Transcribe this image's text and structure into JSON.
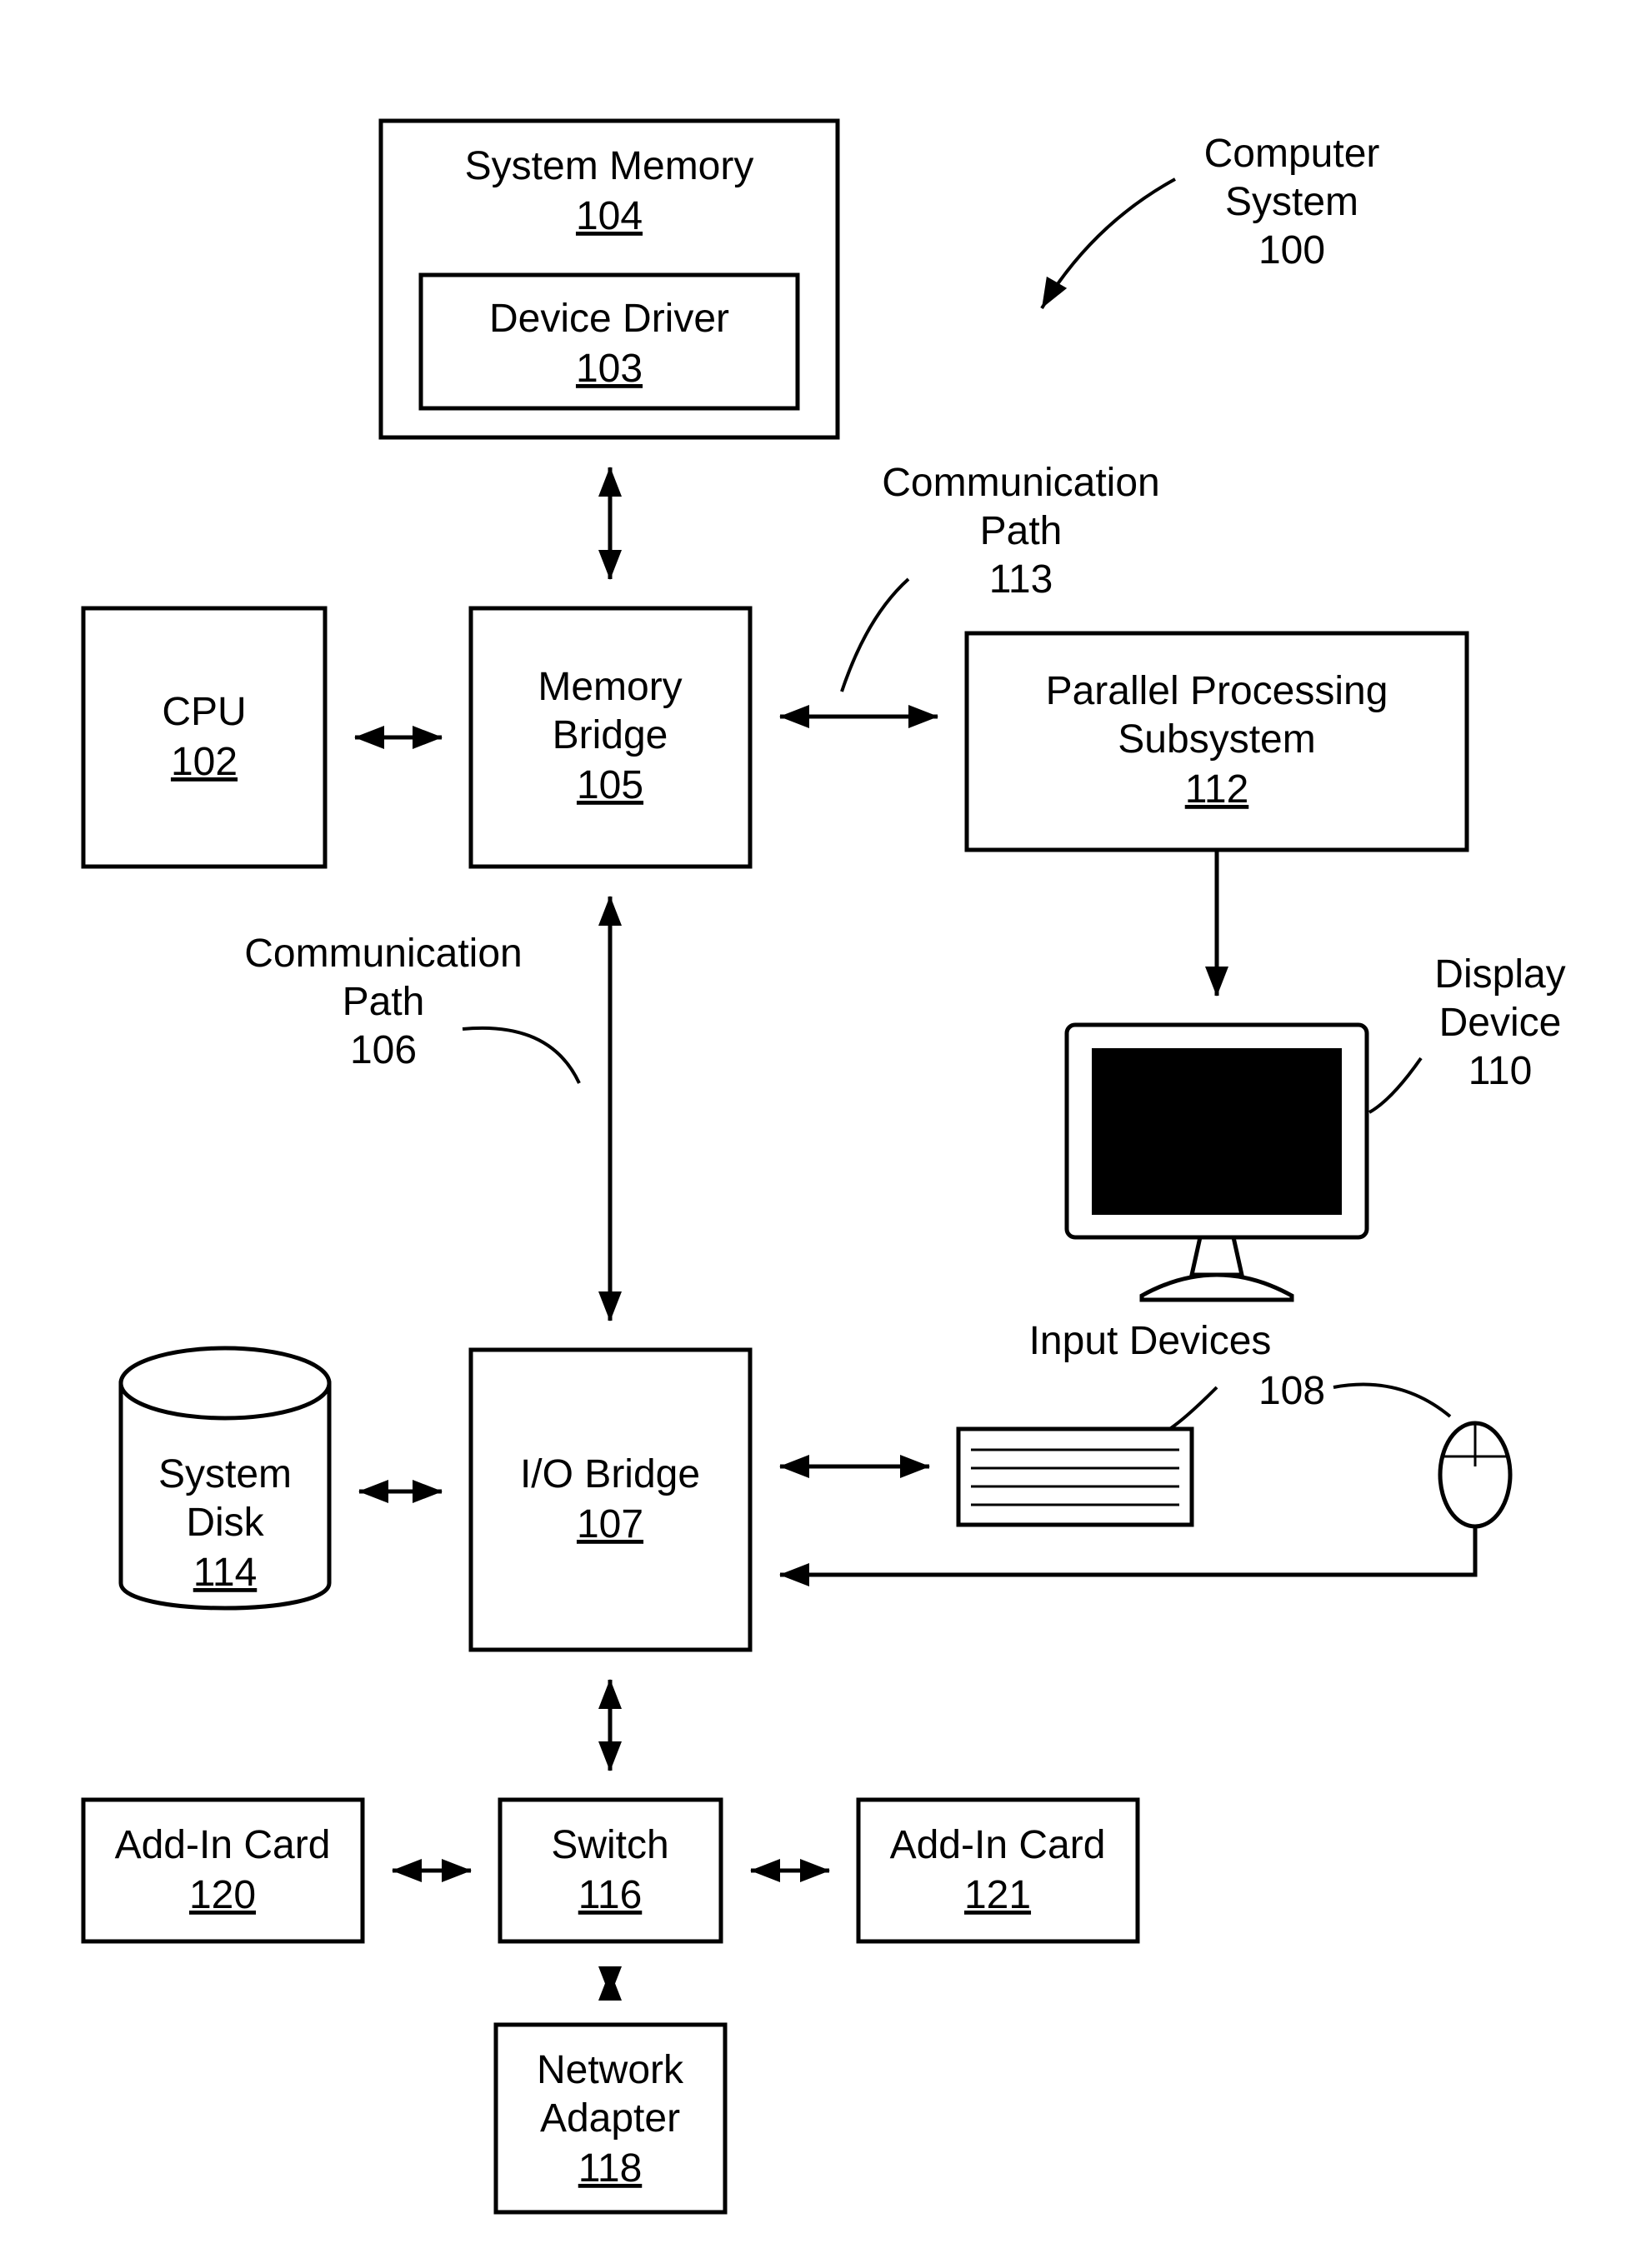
{
  "title": {
    "line1": "Computer",
    "line2": "System",
    "ref": "100"
  },
  "sys_memory": {
    "label": "System Memory",
    "ref": "104"
  },
  "device_driver": {
    "label": "Device Driver",
    "ref": "103"
  },
  "cpu": {
    "label": "CPU",
    "ref": "102"
  },
  "mem_bridge": {
    "line1": "Memory",
    "line2": "Bridge",
    "ref": "105"
  },
  "pps": {
    "line1": "Parallel Processing",
    "line2": "Subsystem",
    "ref": "112"
  },
  "display": {
    "line1": "Display",
    "line2": "Device",
    "ref": "110"
  },
  "io_bridge": {
    "label": "I/O Bridge",
    "ref": "107"
  },
  "sys_disk": {
    "line1": "System",
    "line2": "Disk",
    "ref": "114"
  },
  "input_devices": {
    "label": "Input Devices",
    "ref": "108"
  },
  "addin_left": {
    "label": "Add-In Card",
    "ref": "120"
  },
  "addin_right": {
    "label": "Add-In Card",
    "ref": "121"
  },
  "switch": {
    "label": "Switch",
    "ref": "116"
  },
  "net_adapter": {
    "line1": "Network",
    "line2": "Adapter",
    "ref": "118"
  },
  "comm113": {
    "line1": "Communication",
    "line2": "Path",
    "ref": "113"
  },
  "comm106": {
    "line1": "Communication",
    "line2": "Path",
    "ref": "106"
  }
}
